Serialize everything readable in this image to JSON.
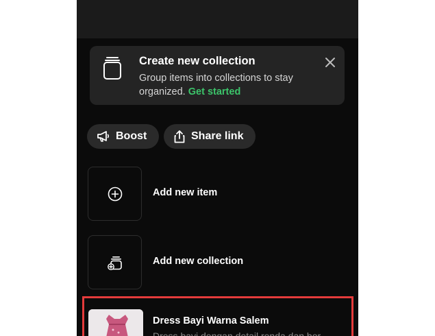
{
  "banner": {
    "title": "Create new collection",
    "description": "Group items into collections to stay organized.",
    "link": "Get started"
  },
  "actions": {
    "boost_label": "Boost",
    "share_label": "Share link"
  },
  "tiles": {
    "add_item_label": "Add new item",
    "add_collection_label": "Add new collection"
  },
  "product": {
    "title": "Dress Bayi Warna Salem",
    "description": "Dress bayi dengan detail renda dan bor"
  },
  "colors": {
    "background": "#0b0b0b",
    "card": "#242424",
    "accent_link": "#3cc46a",
    "highlight_border": "#e43b3b"
  }
}
